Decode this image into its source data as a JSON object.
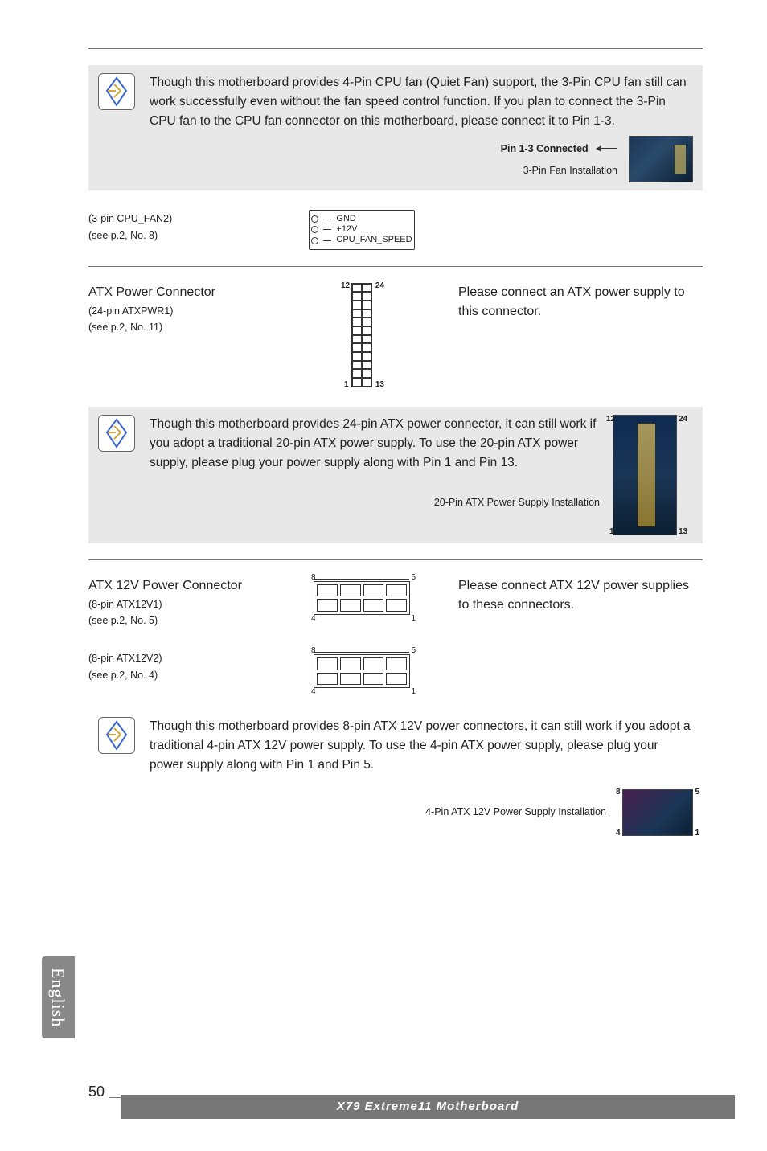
{
  "side_tab": "English",
  "page_number": "50",
  "footer": "X79  Extreme11  Motherboard",
  "warn1": {
    "text": "Though this motherboard provides 4-Pin CPU fan (Quiet Fan) support, the 3-Pin CPU fan still can work successfully even without the fan speed control function. If you plan to connect the 3-Pin CPU fan to the CPU fan connector on this motherboard, please connect it to Pin 1-3.",
    "label_bold": "Pin 1-3 Connected",
    "label_small": "3-Pin Fan Installation"
  },
  "cpu_fan2": {
    "title": "(3-pin CPU_FAN2)",
    "sub": "(see p.2,  No. 8)",
    "pins": [
      "GND",
      "+12V",
      "CPU_FAN_SPEED"
    ]
  },
  "atx24": {
    "title": "ATX Power Connector",
    "sub1": "(24-pin ATXPWR1)",
    "sub2": "(see p.2,  No. 11)",
    "desc": "Please connect an ATX power supply to this connector.",
    "labels": {
      "tl": "12",
      "tr": "24",
      "bl": "1",
      "br": "13"
    }
  },
  "warn2": {
    "text": "Though this motherboard provides 24-pin ATX power connector, it can still work if you adopt a traditional 20-pin ATX power supply. To use the 20-pin ATX power supply, please plug your power supply along with Pin 1 and Pin 13.",
    "caption": "20-Pin ATX Power Supply Installation",
    "labels": {
      "tl": "12",
      "tr": "24",
      "bl": "1",
      "br": "13"
    }
  },
  "atx12v": {
    "title": "ATX 12V Power Connector",
    "sub1": "(8-pin  ATX12V1)",
    "sub2": "(see p.2,  No. 5)",
    "sub3": "(8-pin  ATX12V2)",
    "sub4": "(see p.2,  No. 4)",
    "desc": "Please connect ATX 12V power supplies to these connectors.",
    "labels": {
      "tl": "8",
      "tr": "5",
      "bl": "4",
      "br": "1"
    }
  },
  "warn3": {
    "text": "Though this motherboard provides 8-pin ATX 12V power connectors, it can still work if you adopt a traditional 4-pin ATX 12V power supply. To use the 4-pin ATX power supply, please plug your power supply along with Pin 1 and Pin 5.",
    "caption": "4-Pin ATX 12V Power Supply Installation",
    "labels": {
      "tl": "8",
      "tr": "5",
      "bl": "4",
      "br": "1"
    }
  }
}
